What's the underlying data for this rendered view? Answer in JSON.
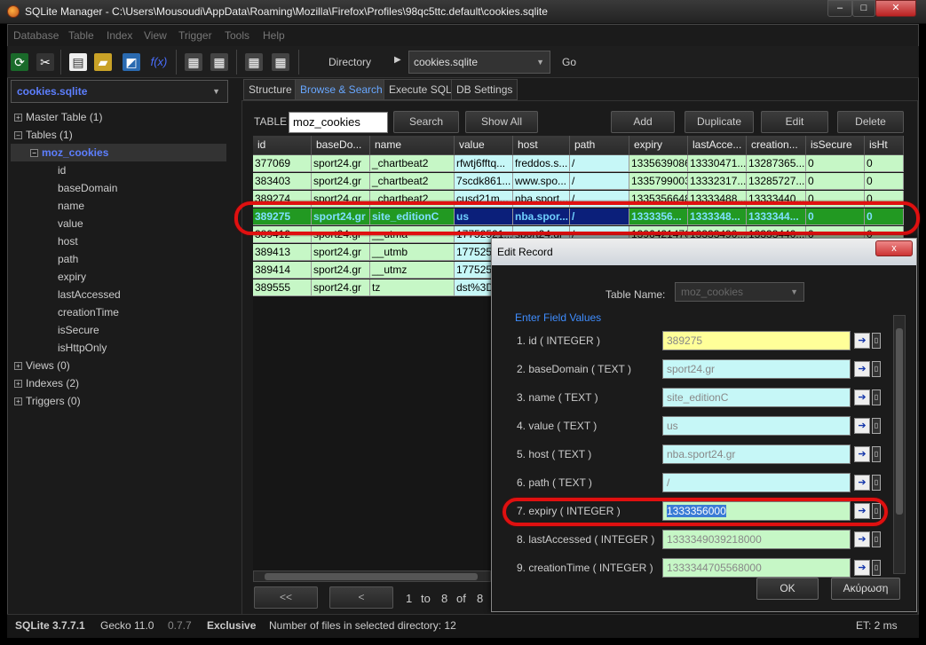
{
  "window": {
    "title": "SQLite Manager - C:\\Users\\Mousoudi\\AppData\\Roaming\\Mozilla\\Firefox\\Profiles\\98qc5ttc.default\\cookies.sqlite"
  },
  "menu": [
    "Database",
    "Table",
    "Index",
    "View",
    "Trigger",
    "Tools",
    "Help"
  ],
  "toolbar": {
    "directory_label": "Directory",
    "directory_value": "cookies.sqlite",
    "go_label": "Go",
    "fx_label": "f(x)"
  },
  "sidebar": {
    "db": "cookies.sqlite",
    "master": "Master Table (1)",
    "tables": "Tables (1)",
    "table_name": "moz_cookies",
    "columns": [
      "id",
      "baseDomain",
      "name",
      "value",
      "host",
      "path",
      "expiry",
      "lastAccessed",
      "creationTime",
      "isSecure",
      "isHttpOnly"
    ],
    "views": "Views (0)",
    "indexes": "Indexes (2)",
    "triggers": "Triggers (0)"
  },
  "tabs": [
    "Structure",
    "Browse & Search",
    "Execute SQL",
    "DB Settings"
  ],
  "browse": {
    "table_label": "TABLE",
    "table_value": "moz_cookies",
    "search": "Search",
    "show_all": "Show All",
    "add": "Add",
    "duplicate": "Duplicate",
    "edit": "Edit",
    "delete": "Delete",
    "headers": [
      "id",
      "baseDo...",
      "name",
      "value",
      "host",
      "path",
      "expiry",
      "lastAcce...",
      "creation...",
      "isSecure",
      "isHt"
    ],
    "rows": [
      [
        "377069",
        "sport24.gr",
        "_chartbeat2",
        "rfwtj6fftq...",
        "freddos.s...",
        "/",
        "1335639086",
        "13330471...",
        "13287365...",
        "0",
        "0"
      ],
      [
        "383403",
        "sport24.gr",
        "_chartbeat2",
        "7scdk861...",
        "www.spo...",
        "/",
        "1335799003",
        "13332317...",
        "13285727...",
        "0",
        "0"
      ],
      [
        "389274",
        "sport24.gr",
        "_chartbeat2",
        "cusd21m...",
        "nba.sport...",
        "/",
        "1335356648",
        "13333488...",
        "13333440...",
        "0",
        "0"
      ],
      [
        "389275",
        "sport24.gr",
        "site_editionC",
        "us",
        "nba.spor...",
        "/",
        "1333356...",
        "1333348...",
        "1333344...",
        "0",
        "0"
      ],
      [
        "389412",
        "sport24.gr",
        "__utma",
        "17752521...",
        "sport24.gr",
        "/",
        "1396421470",
        "13333490...",
        "13333440...",
        "0",
        "0"
      ],
      [
        "389413",
        "sport24.gr",
        "__utmb",
        "177525...",
        "",
        "",
        "",
        "",
        "",
        "",
        ""
      ],
      [
        "389414",
        "sport24.gr",
        "__utmz",
        "177525...",
        "",
        "",
        "",
        "",
        "",
        "",
        ""
      ],
      [
        "389555",
        "sport24.gr",
        "tz",
        "dst%3D...",
        "",
        "",
        "",
        "",
        "",
        "",
        ""
      ]
    ],
    "nav_first": "<<",
    "nav_prev": "<",
    "page_from": "1",
    "page_to_label": "to",
    "page_to": "8",
    "page_of_label": "of",
    "page_total": "8"
  },
  "dialog": {
    "title": "Edit Record",
    "close": "x",
    "table_name_label": "Table Name:",
    "table_name_value": "moz_cookies",
    "enter_label": "Enter Field Values",
    "fields": [
      {
        "label": "1. id ( INTEGER )",
        "value": "389275"
      },
      {
        "label": "2. baseDomain ( TEXT )",
        "value": "sport24.gr"
      },
      {
        "label": "3. name ( TEXT )",
        "value": "site_editionC"
      },
      {
        "label": "4. value ( TEXT )",
        "value": "us"
      },
      {
        "label": "5. host ( TEXT )",
        "value": "nba.sport24.gr"
      },
      {
        "label": "6. path ( TEXT )",
        "value": "/"
      },
      {
        "label": "7. expiry ( INTEGER )",
        "value": "1333356000"
      },
      {
        "label": "8. lastAccessed ( INTEGER )",
        "value": "1333349039218000"
      },
      {
        "label": "9. creationTime ( INTEGER )",
        "value": "1333344705568000"
      }
    ],
    "ok": "OK",
    "cancel": "Ακύρωση"
  },
  "status": {
    "sqlite": "SQLite 3.7.7.1",
    "gecko": "Gecko 11.0",
    "version": "0.7.7",
    "mode": "Exclusive",
    "files": "Number of files in selected directory: 12",
    "et": "ET: 2 ms"
  }
}
